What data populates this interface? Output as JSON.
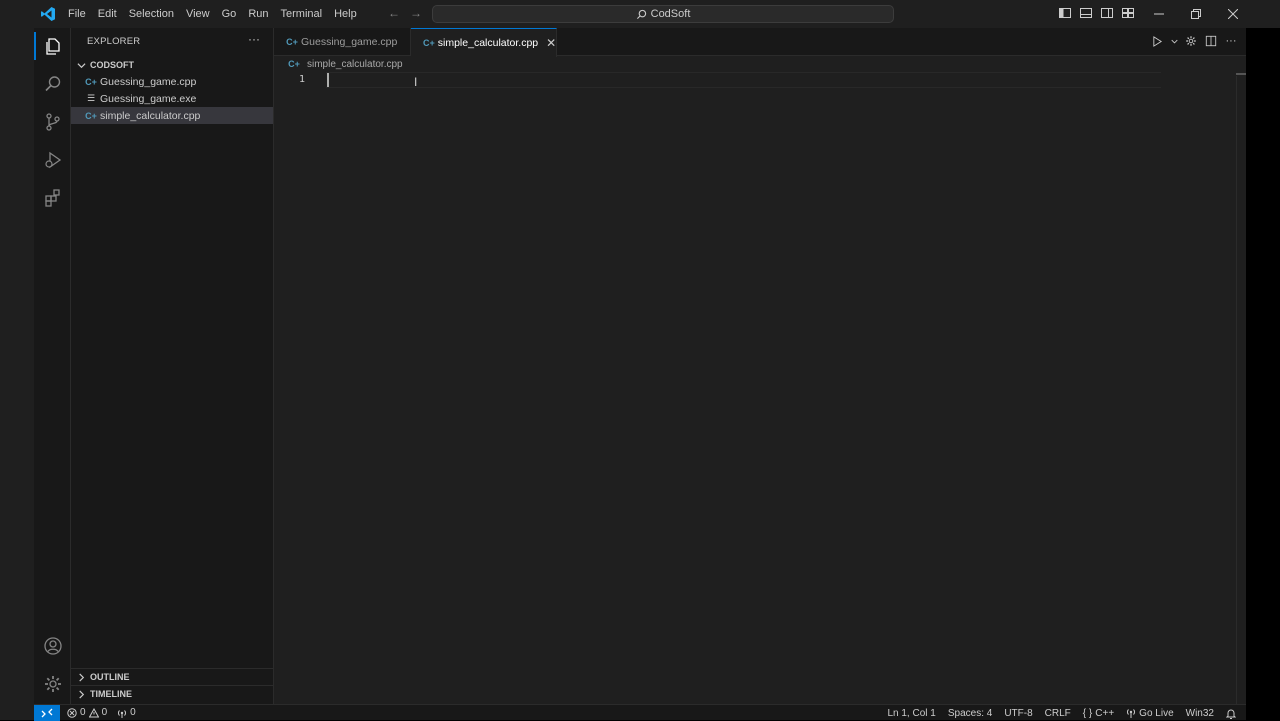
{
  "titlebar": {
    "menus": [
      "File",
      "Edit",
      "Selection",
      "View",
      "Go",
      "Run",
      "Terminal",
      "Help"
    ],
    "search_text": "CodSoft"
  },
  "sidebar": {
    "header": "EXPLORER",
    "folder": "CODSOFT",
    "files": [
      {
        "name": "Guessing_game.cpp",
        "icon": "cpp-file-icon"
      },
      {
        "name": "Guessing_game.exe",
        "icon": "exe-file-icon"
      },
      {
        "name": "simple_calculator.cpp",
        "icon": "cpp-file-icon",
        "selected": true
      }
    ],
    "outline": "OUTLINE",
    "timeline": "TIMELINE"
  },
  "editor": {
    "tabs": [
      {
        "label": "Guessing_game.cpp",
        "active": false
      },
      {
        "label": "simple_calculator.cpp",
        "active": true
      }
    ],
    "breadcrumb": "simple_calculator.cpp",
    "line_numbers": [
      "1"
    ]
  },
  "statusbar": {
    "errors": "0",
    "warnings": "0",
    "ports": "0",
    "position": "Ln 1, Col 1",
    "spaces": "Spaces: 4",
    "encoding": "UTF-8",
    "eol": "CRLF",
    "language": "C++",
    "language_prefix": "{ }",
    "golive": "Go Live",
    "platform": "Win32"
  },
  "colors": {
    "accent": "#0078d4",
    "cpp_icon": "#519aba"
  }
}
